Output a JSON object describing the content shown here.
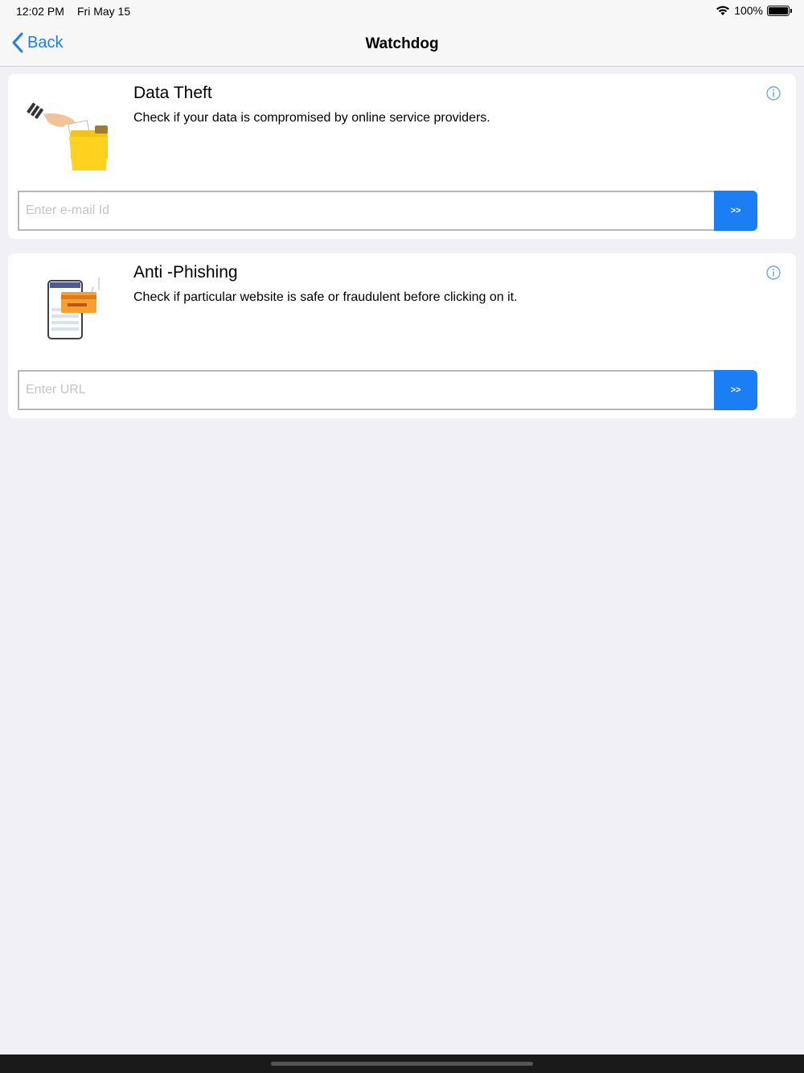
{
  "status_bar": {
    "time": "12:02 PM",
    "date": "Fri May 15",
    "battery": "100%"
  },
  "nav": {
    "back_label": "Back",
    "title": "Watchdog"
  },
  "cards": [
    {
      "title": "Data Theft",
      "description": "Check if your data is compromised by online service providers.",
      "input_placeholder": "Enter e-mail Id",
      "button_label": ">>"
    },
    {
      "title": "Anti -Phishing",
      "description": "Check if particular website is safe or fraudulent before clicking on it.",
      "input_placeholder": "Enter URL",
      "button_label": ">>"
    }
  ],
  "colors": {
    "accent": "#1f7cf0",
    "button": "#1b7ef5",
    "background": "#f0f0f5"
  }
}
